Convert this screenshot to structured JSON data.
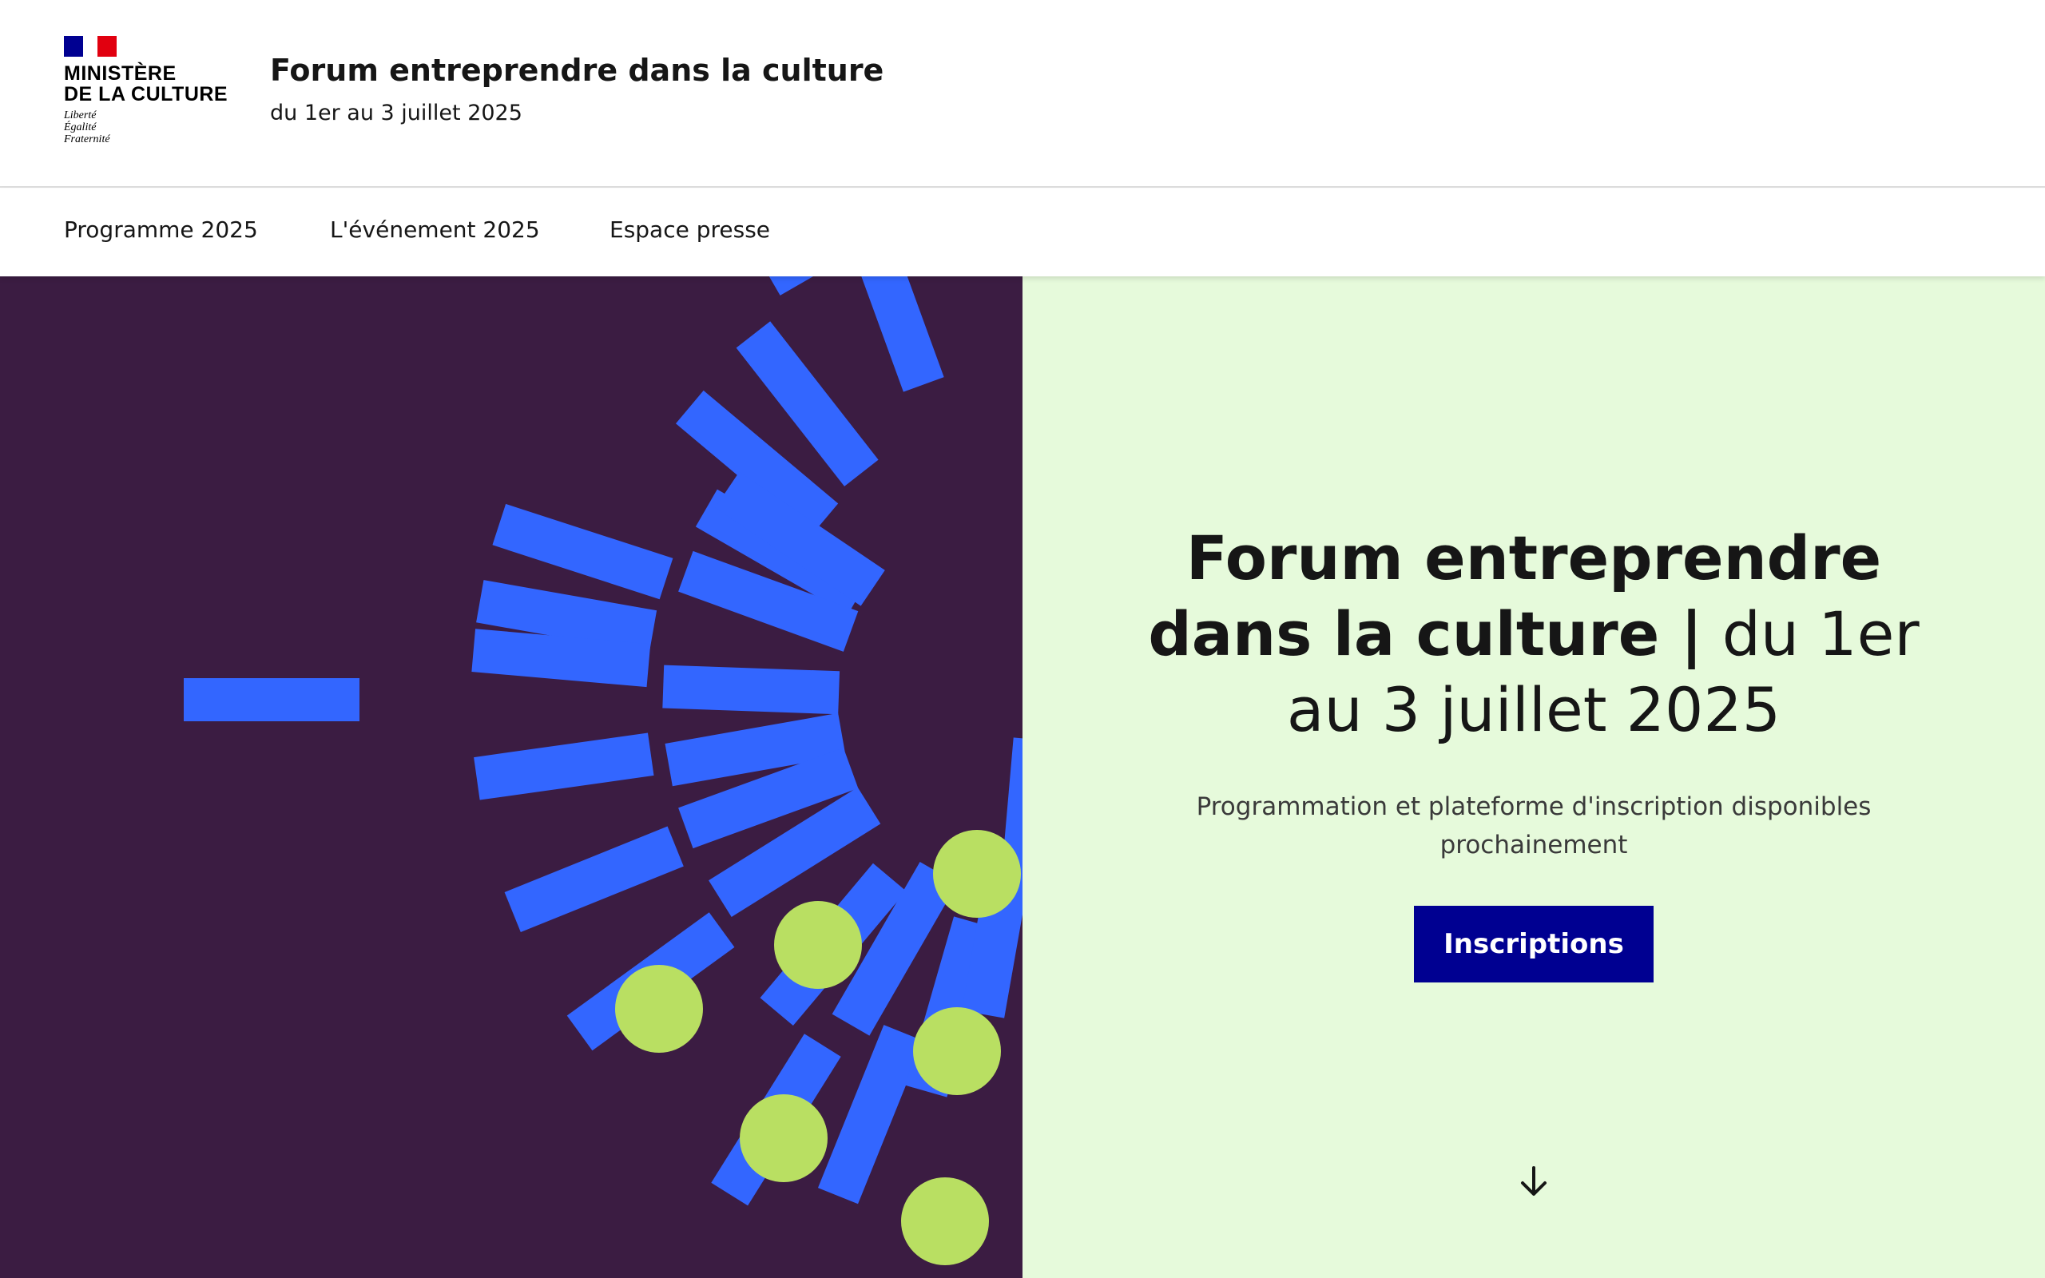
{
  "header": {
    "logo": {
      "name": "MINISTÈRE\nDE LA CULTURE",
      "motto": "Liberté\nÉgalité\nFraternité",
      "icon": "marianne-flag-icon"
    },
    "site_title": "Forum entreprendre dans la culture",
    "site_tagline": "du 1er au 3 juillet 2025"
  },
  "nav": {
    "items": [
      {
        "label": "Programme 2025"
      },
      {
        "label": "L'événement 2025"
      },
      {
        "label": "Espace presse"
      }
    ]
  },
  "hero": {
    "title_bold": "Forum entreprendre dans la culture |",
    "title_rest": " du 1er au 3 juillet 2025",
    "subtitle": "Programmation et plateforme d'inscription disponibles prochainement",
    "cta_label": "Inscriptions",
    "scroll_icon": "arrow-down-icon"
  },
  "colors": {
    "brand_blue": "#000091",
    "hero_left_bg": "#3b1c42",
    "hero_right_bg": "#e6fadb",
    "ray_blue": "#3366ff",
    "dot_green": "#b9df62",
    "flag_blue": "#000091",
    "flag_red": "#e1000f"
  }
}
